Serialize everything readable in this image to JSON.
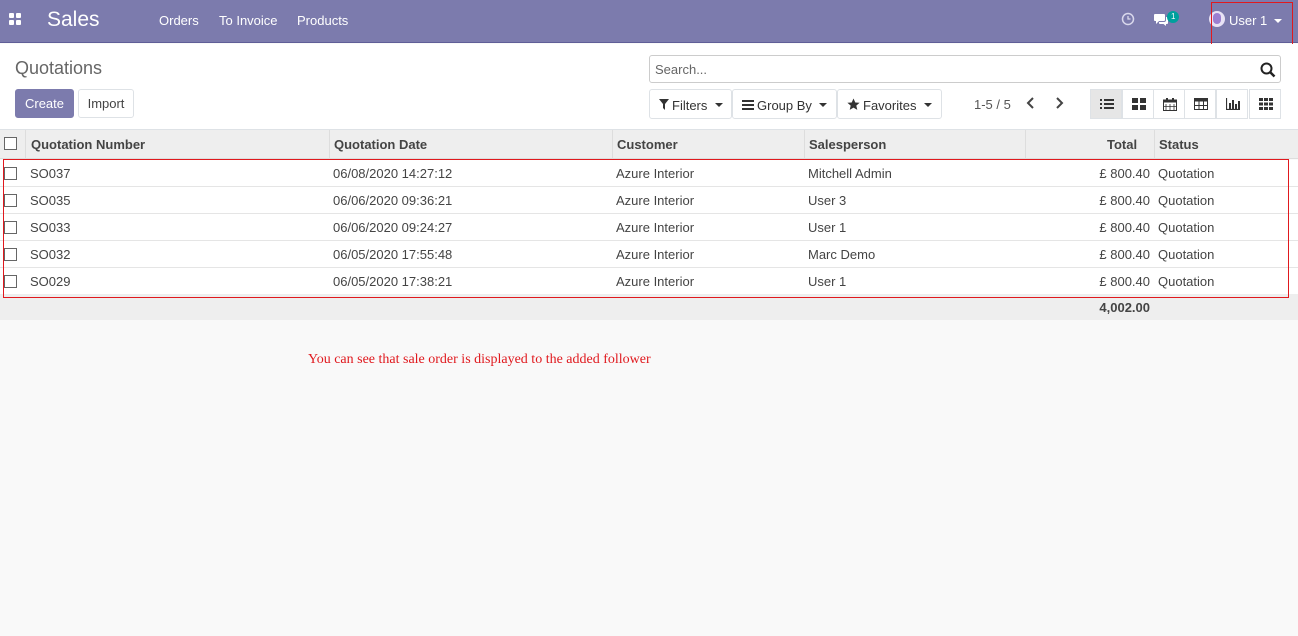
{
  "navbar": {
    "brand": "Sales",
    "menu": [
      "Orders",
      "To Invoice",
      "Products"
    ],
    "chat_badge": "1",
    "user_name": "User 1"
  },
  "control": {
    "title": "Quotations",
    "create_label": "Create",
    "import_label": "Import",
    "search_placeholder": "Search...",
    "filters_label": "Filters",
    "groupby_label": "Group By",
    "favorites_label": "Favorites",
    "pager": "1-5 / 5",
    "views": [
      "list-view-icon",
      "kanban-view-icon",
      "calendar-view-icon",
      "pivot-view-icon",
      "graph-view-icon",
      "activity-view-icon"
    ]
  },
  "table": {
    "headers": [
      "Quotation Number",
      "Quotation Date",
      "Customer",
      "Salesperson",
      "Total",
      "Status"
    ],
    "rows": [
      {
        "number": "SO037",
        "date": "06/08/2020 14:27:12",
        "customer": "Azure Interior",
        "salesperson": "Mitchell Admin",
        "total": "£ 800.40",
        "status": "Quotation"
      },
      {
        "number": "SO035",
        "date": "06/06/2020 09:36:21",
        "customer": "Azure Interior",
        "salesperson": "User 3",
        "total": "£ 800.40",
        "status": "Quotation"
      },
      {
        "number": "SO033",
        "date": "06/06/2020 09:24:27",
        "customer": "Azure Interior",
        "salesperson": "User 1",
        "total": "£ 800.40",
        "status": "Quotation"
      },
      {
        "number": "SO032",
        "date": "06/05/2020 17:55:48",
        "customer": "Azure Interior",
        "salesperson": "Marc Demo",
        "total": "£ 800.40",
        "status": "Quotation"
      },
      {
        "number": "SO029",
        "date": "06/05/2020 17:38:21",
        "customer": "Azure Interior",
        "salesperson": "User 1",
        "total": "£ 800.40",
        "status": "Quotation"
      }
    ],
    "footer_total": "4,002.00"
  },
  "annotation": "You can see that sale order is displayed to the added follower",
  "colors": {
    "brand": "#7c7bad",
    "highlight": "#e0191e",
    "badge": "#00a09d"
  }
}
